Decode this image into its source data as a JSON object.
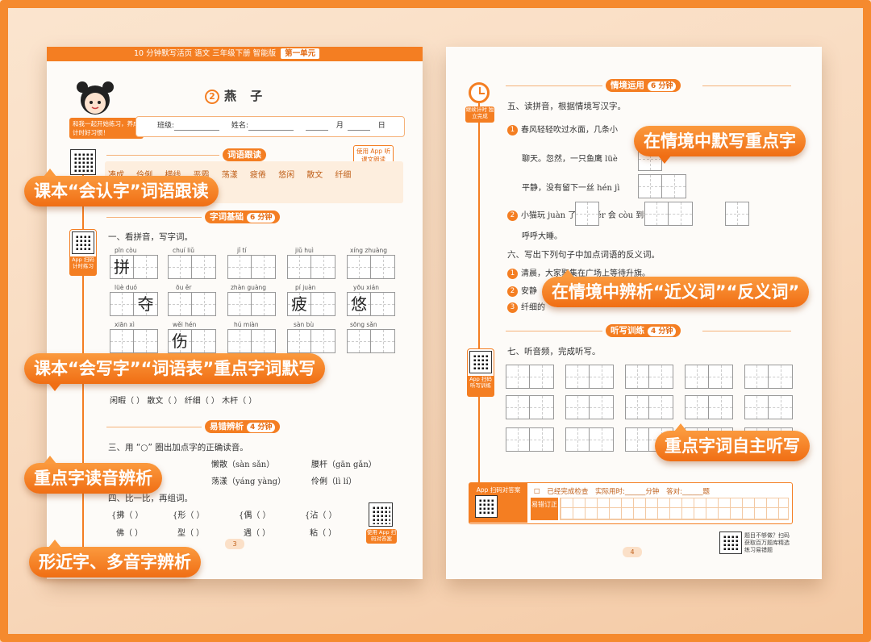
{
  "left_page": {
    "header": {
      "text": "10 分钟默写活页  语文  三年级下册  智能版",
      "unit": "第一单元"
    },
    "lesson_no": "2",
    "lesson_title": "燕 子",
    "mascot_tip": "和我一起开始练习，养成计时好习惯！",
    "info": {
      "class": "班级:",
      "name": "姓名:",
      "month": "月",
      "day": "日"
    },
    "sec1": {
      "title": "词语跟读",
      "audio_btn": "使用 App 听课文朗读",
      "words": "凑成  伶俐  横线  恶霸  荡漾  疲倦  悠闲  散文  纤细"
    },
    "qr_caption1": "App 扫码计时练习",
    "sec2": {
      "title": "字词基础",
      "time": "6 分钟",
      "q1": "一、看拼音，写字词。"
    },
    "pinyin_rows": [
      [
        "pīn còu",
        "chuí liǔ",
        "jǐ tí",
        "jiǔ huì",
        "xíng zhuàng"
      ],
      [
        "lüè duó",
        "ōu ěr",
        "zhàn guàng",
        "pí juàn",
        "yōu xián"
      ],
      [
        "xiān xì",
        "wěi hén",
        "hú miàn",
        "sàn bù",
        "sōng sǎn"
      ]
    ],
    "grid_chars": {
      "r0": "拼",
      "r1a": "夺",
      "r1b": "疲",
      "r1c": "悠",
      "r2": "伤"
    },
    "q2_lines": [
      "闲暇（      ）    散文（      ）    纤细（      ）    木杆（      ）"
    ],
    "sec3": {
      "title": "易错辨析",
      "time": "4 分钟",
      "q3": "三、用 “○” 圈出加点字的正确读音。"
    },
    "q3_items": [
      "懒散（sàn sǎn）",
      "腰杆（gān gǎn）",
      "荡漾（yáng yàng）",
      "伶俐（lì lí）"
    ],
    "q4": "四、比一比，再组词。",
    "q4_pairs": [
      [
        "拂（    ）",
        "佛（    ）"
      ],
      [
        "形（    ）",
        "型（    ）"
      ],
      [
        "偶（    ）",
        "遇（    ）"
      ],
      [
        "沾（    ）",
        "粘（    ）"
      ]
    ],
    "qr_caption2": "使用 App 扫码对答案",
    "page_num": "3"
  },
  "right_page": {
    "clock_caption": "继续计时 独立完成",
    "sec4": {
      "title": "情境运用",
      "time": "6 分钟",
      "q5": "五、读拼音，根据情境写汉字。"
    },
    "q5_lines": [
      "春风轻轻吹过水面，几条小",
      "聊天。忽然，一只鱼鹰 lüè",
      "平静，没有留下一丝 hén jì",
      "小猫玩 juàn          了，òu ěr              会 còu              到我跟前",
      "呼呼大睡。"
    ],
    "q6": "六、写出下列句子中加点词语的反义词。",
    "q6_items": [
      "清晨，大家聚集在广场上等待升旗。",
      "安静",
      "纤细的"
    ],
    "sec5": {
      "title": "听写训练",
      "time": "4 分钟",
      "q7": "七、听音频，完成听写。"
    },
    "qr_caption3": "App 扫码听写训练",
    "answer": {
      "scan": "App 扫码对答案",
      "done": "已经完成检查",
      "time_label": "实际用时:",
      "minute": "分钟",
      "correct_label": "答对:",
      "questions": "题",
      "fix": "易错订正"
    },
    "more": "题目不够做？扫码获取百万题库精选练习易错题",
    "page_num": "4"
  },
  "callouts": [
    "课本“会认字”词语跟读",
    "课本“会写字”“词语表”重点字词默写",
    "重点字读音辨析",
    "形近字、多音字辨析",
    "在情境中默写重点字",
    "在情境中辨析“近义词”“反义词”",
    "重点字词自主听写"
  ],
  "colors": {
    "accent": "#f47e22",
    "background": "#f8d9bd"
  }
}
